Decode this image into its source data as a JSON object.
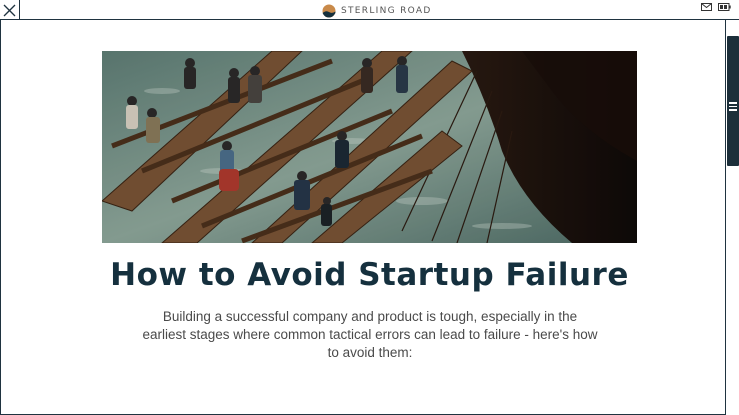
{
  "header": {
    "brand_name": "STERLING ROAD",
    "close_icon": "close-icon",
    "mail_icon": "mail-icon",
    "battery_icon": "battery-icon"
  },
  "colors": {
    "dark": "#15303e",
    "frame": "#1f3340",
    "brand_accent": "#c98a4a",
    "text": "#4a4a4a"
  },
  "article": {
    "title": "How to Avoid Startup Failure",
    "subtitle": "Building a successful company and product is tough, especially in the earliest stages where common tactical errors can lead to failure - here's how to avoid them:"
  },
  "scrollbar": {
    "grip_icon": "menu-grip-icon"
  }
}
